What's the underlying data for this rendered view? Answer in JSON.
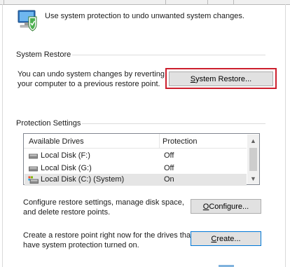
{
  "header": {
    "description": "Use system protection to undo unwanted system changes."
  },
  "system_restore": {
    "group_label": "System Restore",
    "description_line1": "You can undo system changes by reverting",
    "description_line2": "your computer to a previous restore point.",
    "button": {
      "accel": "S",
      "rest": "ystem Restore..."
    }
  },
  "protection": {
    "group_label": "Protection Settings",
    "columns": [
      "Available Drives",
      "Protection"
    ],
    "drives": [
      {
        "name": "Local Disk (F:)",
        "protection": "Off",
        "icon": "hard-drive-icon"
      },
      {
        "name": "Local Disk (G:)",
        "protection": "Off",
        "icon": "hard-drive-icon"
      },
      {
        "name": "Local Disk (C:) (System)",
        "protection": "On",
        "icon": "system-drive-icon"
      }
    ],
    "configure": {
      "line1": "Configure restore settings, manage disk space,",
      "line2": "and delete restore points.",
      "button": {
        "accel": "O",
        "rest": "Configure...",
        "pre": ""
      }
    },
    "create": {
      "line1": "Create a restore point right now for the drives that",
      "line2": "have system protection turned on.",
      "button": {
        "pre": "",
        "accel": "C",
        "rest": "reate..."
      }
    }
  },
  "colors": {
    "highlight_border": "#cc1f2d",
    "focus_border": "#0078d7",
    "selected_row": "#e5e5e5"
  }
}
